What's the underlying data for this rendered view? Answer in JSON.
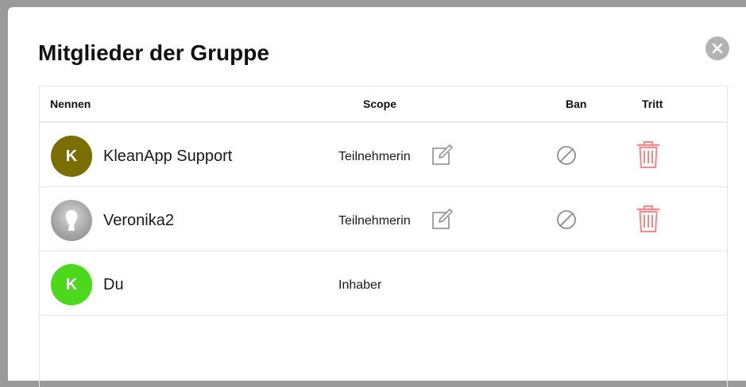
{
  "dialog": {
    "title": "Mitglieder der Gruppe",
    "close_icon": "close-icon"
  },
  "table": {
    "headers": {
      "name": "Nennen",
      "scope": "Scope",
      "ban": "Ban",
      "kick": "Tritt"
    },
    "rows": [
      {
        "initial": "K",
        "avatar_color": "#7a6e00",
        "name": "KleanApp Support",
        "scope": "Teilnehmerin",
        "edit_icon": "edit-icon",
        "ban_icon": "ban-icon",
        "kick_icon": "trash-icon"
      },
      {
        "initial": "",
        "avatar_color": "#a6a6a6",
        "name": "Veronika2",
        "scope": "Teilnehmerin",
        "edit_icon": "edit-icon",
        "ban_icon": "ban-icon",
        "kick_icon": "trash-icon"
      },
      {
        "initial": "K",
        "avatar_color": "#4cd91c",
        "name": "Du",
        "scope": "Inhaber"
      }
    ]
  },
  "colors": {
    "icon_gray": "#9a9a9a",
    "trash_red": "#ef8a8a",
    "close_gray": "#b3b3b3"
  }
}
